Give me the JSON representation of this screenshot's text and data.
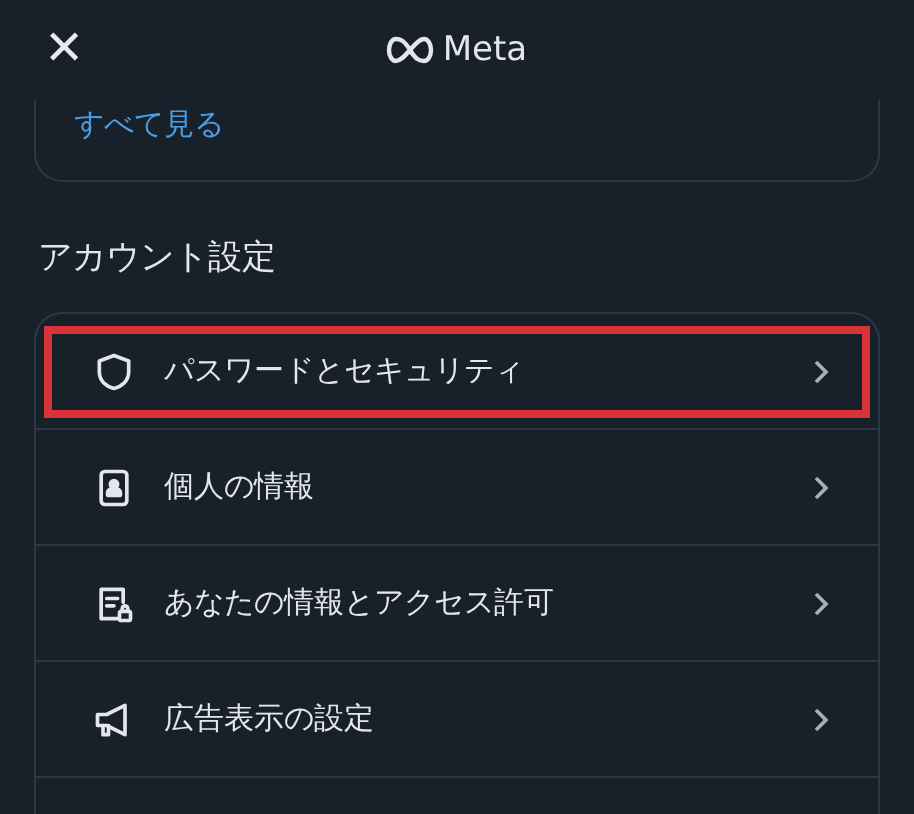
{
  "header": {
    "close": "✕",
    "brand": "Meta"
  },
  "top_card": {
    "link": "すべて見る"
  },
  "section": {
    "title": "アカウント設定",
    "items": [
      {
        "kind": "security",
        "label": "パスワードとセキュリティ",
        "highlighted": true
      },
      {
        "kind": "profile",
        "label": "個人の情報",
        "highlighted": false
      },
      {
        "kind": "info-access",
        "label": "あなたの情報とアクセス許可",
        "highlighted": false
      },
      {
        "kind": "ads",
        "label": "広告表示の設定",
        "highlighted": false
      }
    ]
  }
}
